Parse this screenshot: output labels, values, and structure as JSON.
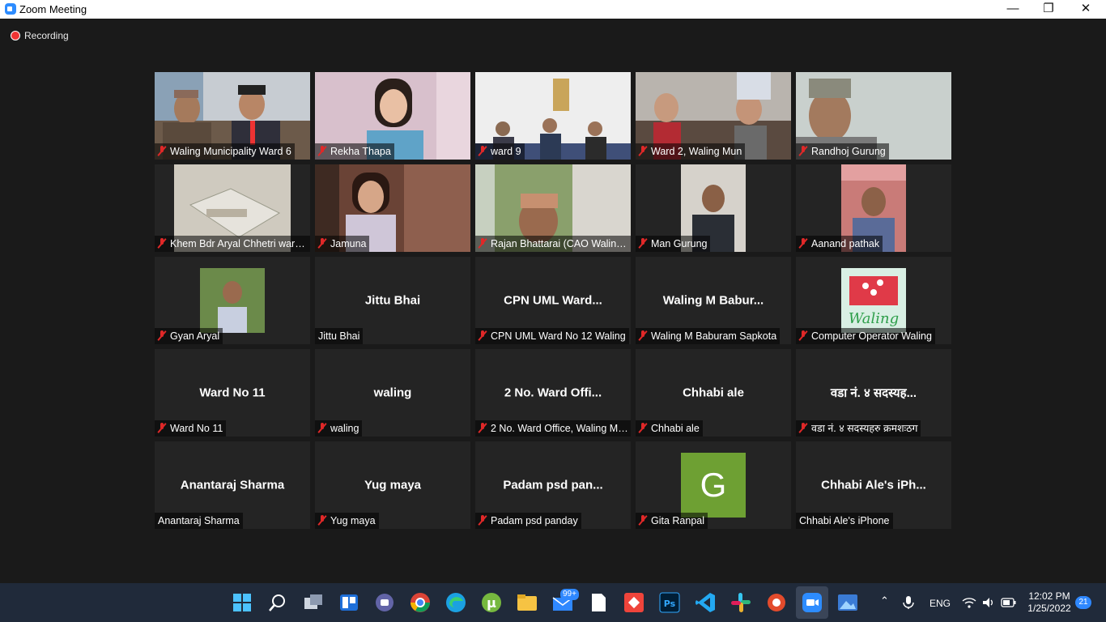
{
  "window": {
    "title": "Zoom Meeting",
    "controls": [
      "—",
      "❐",
      "✕"
    ]
  },
  "recording": {
    "label": "Recording"
  },
  "participants": [
    {
      "name": "Waling Municipality Ward 6",
      "muted": true,
      "video": true
    },
    {
      "name": "Rekha Thapa",
      "muted": true,
      "video": true
    },
    {
      "name": "ward 9",
      "muted": true,
      "video": true
    },
    {
      "name": "Ward 2, Waling Mun",
      "muted": true,
      "video": true
    },
    {
      "name": "Randhoj Gurung",
      "muted": true,
      "video": true
    },
    {
      "name": "Khem Bdr Aryal Chhetri ward 13",
      "muted": true,
      "video": true
    },
    {
      "name": "Jamuna",
      "muted": true,
      "video": true
    },
    {
      "name": "Rajan Bhattarai (CAO Waling Municipality)",
      "muted": true,
      "video": true
    },
    {
      "name": "Man Gurung",
      "muted": true,
      "video": true
    },
    {
      "name": "Aanand pathak",
      "muted": true,
      "video": true
    },
    {
      "name": "Gyan Aryal",
      "muted": true,
      "video": true
    },
    {
      "name": "Jittu Bhai",
      "display": "Jittu Bhai",
      "muted": false,
      "video": false
    },
    {
      "name": "CPN UML Ward No 12 Waling",
      "display": "CPN  UML  Ward...",
      "muted": true,
      "video": false
    },
    {
      "name": "Waling M Baburam Sapkota",
      "display": "Waling  M  Babur...",
      "muted": true,
      "video": false
    },
    {
      "name": "Computer Operator Waling",
      "muted": true,
      "video": true,
      "logo": "Waling SMART"
    },
    {
      "name": "Ward No 11",
      "display": "Ward No 11",
      "muted": true,
      "video": false
    },
    {
      "name": "waling",
      "display": "waling",
      "muted": true,
      "video": false
    },
    {
      "name": "2 No. Ward Office, Waling Municipality",
      "display": "2  No.  Ward Offi...",
      "muted": true,
      "video": false
    },
    {
      "name": "Chhabi ale",
      "display": "Chhabi ale",
      "muted": true,
      "video": false
    },
    {
      "name": "वडा नं. ४ सदस्यहरु क्रमशःठग",
      "display": "वडा नं. ४ सदस्यह...",
      "muted": true,
      "video": false
    },
    {
      "name": "Anantaraj Sharma",
      "display": "Anantaraj Sharma",
      "muted": false,
      "video": false
    },
    {
      "name": "Yug maya",
      "display": "Yug maya",
      "muted": true,
      "video": false
    },
    {
      "name": "Padam psd panday",
      "display": "Padam  psd  pan...",
      "muted": true,
      "video": false
    },
    {
      "name": "Gita Ranpal",
      "muted": true,
      "video": false,
      "avatar": "G"
    },
    {
      "name": "Chhabi Ale's iPhone",
      "display": "Chhabi  Ale's  iPh...",
      "muted": false,
      "video": false
    }
  ],
  "taskbar": {
    "icons": [
      "windows-start-icon",
      "search-icon",
      "task-view-icon",
      "widgets-icon",
      "teams-chat-icon",
      "chrome-icon",
      "edge-icon",
      "utorrent-icon",
      "file-explorer-icon",
      "mail-icon",
      "notepad-icon",
      "anydesk-icon",
      "photoshop-icon",
      "vscode-icon",
      "slack-icon",
      "remote-icon",
      "zoom-icon",
      "photos-icon"
    ],
    "mail_badge": "99+",
    "language": "ENG",
    "time": "12:02 PM",
    "date": "1/25/2022",
    "notifications": "21",
    "colors": {
      "accent": "#2d8cff",
      "muted_mic": "#e02828",
      "avatar_g": "#6ea033"
    }
  }
}
